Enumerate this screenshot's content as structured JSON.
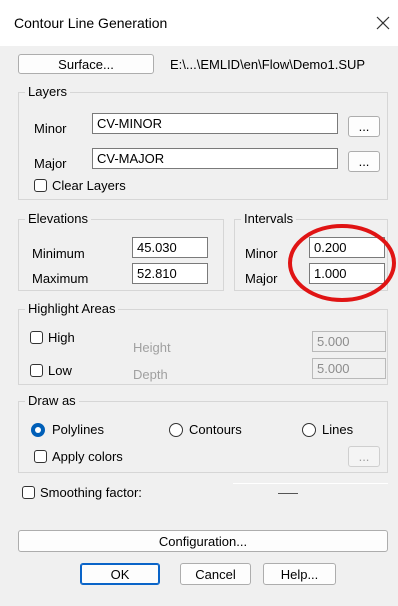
{
  "dialog": {
    "title": "Contour Line Generation",
    "close_icon": "close-icon"
  },
  "surface": {
    "button_label": "Surface...",
    "path": "E:\\...\\EMLID\\en\\Flow\\Demo1.SUP"
  },
  "layers": {
    "legend": "Layers",
    "minor_label": "Minor",
    "minor_value": "CV-MINOR",
    "major_label": "Major",
    "major_value": "CV-MAJOR",
    "browse_label": "...",
    "clear_layers_label": "Clear Layers",
    "clear_layers_checked": false
  },
  "elevations": {
    "legend": "Elevations",
    "minimum_label": "Minimum",
    "minimum_value": "45.030",
    "maximum_label": "Maximum",
    "maximum_value": "52.810"
  },
  "intervals": {
    "legend": "Intervals",
    "minor_label": "Minor",
    "minor_value": "0.200",
    "major_label": "Major",
    "major_value": "1.000",
    "annotation_color": "#e01414"
  },
  "highlight": {
    "legend": "Highlight Areas",
    "high_label": "High",
    "height_label": "Height",
    "height_value": "5.000",
    "low_label": "Low",
    "depth_label": "Depth",
    "depth_value": "5.000"
  },
  "draw_as": {
    "legend": "Draw as",
    "polylines_label": "Polylines",
    "contours_label": "Contours",
    "lines_label": "Lines",
    "selected": "Polylines",
    "apply_colors_label": "Apply colors",
    "colors_button_label": "..."
  },
  "smoothing": {
    "label": "Smoothing factor:"
  },
  "buttons": {
    "configuration": "Configuration...",
    "ok": "OK",
    "cancel": "Cancel",
    "help": "Help..."
  },
  "colors": {
    "accent": "#005fb8",
    "background": "#f0f0f0"
  }
}
